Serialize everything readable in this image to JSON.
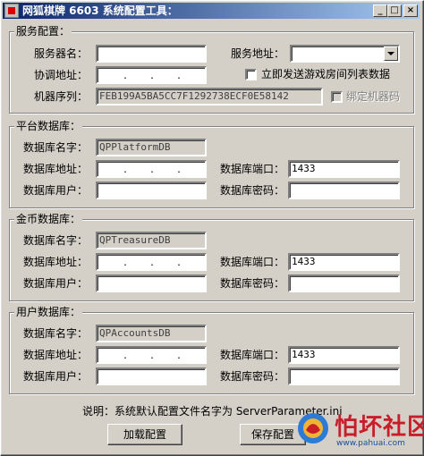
{
  "window": {
    "title": "网狐棋牌 6603 系统配置工具：",
    "min_label": "_",
    "max_label": "□",
    "close_label": "×"
  },
  "service": {
    "legend": "服务配置：",
    "name_label": "服务器名：",
    "name_value": "",
    "address_label": "服务地址：",
    "address_value": "",
    "coord_label": "协调地址：",
    "send_list_label": "立即发送游戏房间列表数据",
    "serial_label": "机器序列：",
    "serial_value": "FEB199A5BA5CC7F1292738ECF0E58142",
    "bind_label": "绑定机器码"
  },
  "platform_db": {
    "legend": "平台数据库：",
    "name_label": "数据库名字：",
    "name_value": "QPPlatformDB",
    "addr_label": "数据库地址：",
    "port_label": "数据库端口：",
    "port_value": "1433",
    "user_label": "数据库用户：",
    "user_value": "",
    "pwd_label": "数据库密码：",
    "pwd_value": ""
  },
  "treasure_db": {
    "legend": "金币数据库：",
    "name_label": "数据库名字：",
    "name_value": "QPTreasureDB",
    "addr_label": "数据库地址：",
    "port_label": "数据库端口：",
    "port_value": "1433",
    "user_label": "数据库用户：",
    "user_value": "",
    "pwd_label": "数据库密码：",
    "pwd_value": ""
  },
  "accounts_db": {
    "legend": "用户数据库：",
    "name_label": "数据库名字：",
    "name_value": "QPAccountsDB",
    "addr_label": "数据库地址：",
    "port_label": "数据库端口：",
    "port_value": "1433",
    "user_label": "数据库用户：",
    "user_value": "",
    "pwd_label": "数据库密码：",
    "pwd_value": ""
  },
  "footer": {
    "note": "说明：系统默认配置文件名字为 ServerParameter.ini",
    "load_button": "加载配置",
    "save_button": "保存配置"
  },
  "watermark": {
    "text": "怕坏社区",
    "url": "www.pahuai.com"
  }
}
